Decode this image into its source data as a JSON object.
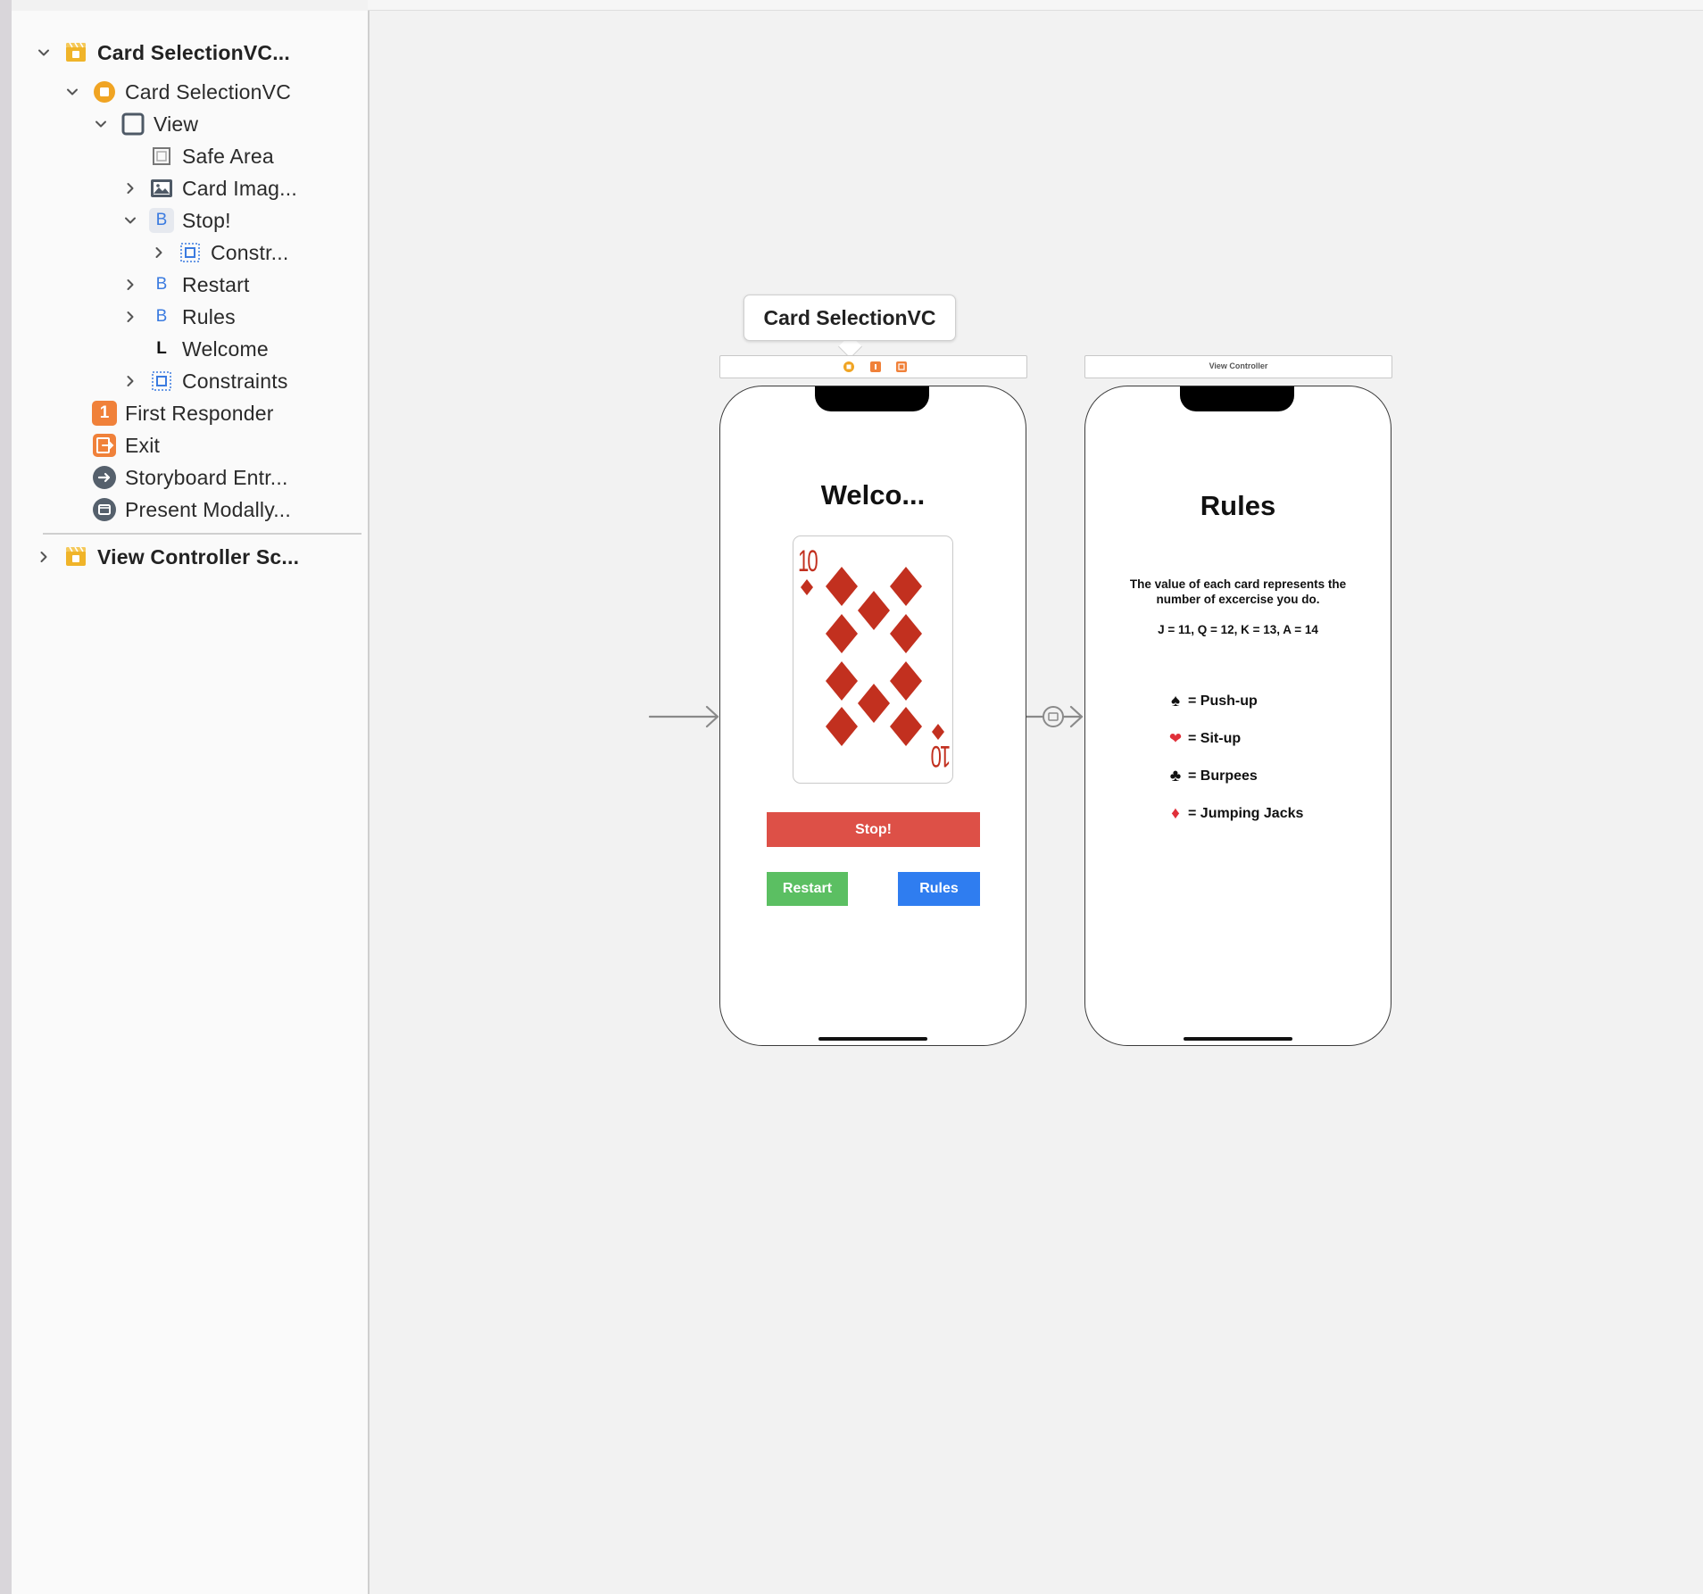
{
  "navigator": {
    "items": [
      {
        "label": "Card SelectionVC...",
        "icon": "scene-icon"
      },
      {
        "label": "Card SelectionVC",
        "icon": "view-controller-icon"
      },
      {
        "label": "View",
        "icon": "view-icon"
      },
      {
        "label": "Safe Area",
        "icon": "safe-area-icon"
      },
      {
        "label": "Card Imag...",
        "icon": "image-view-icon"
      },
      {
        "label": "Stop!",
        "icon": "button-icon",
        "glyph": "B"
      },
      {
        "label": "Constr...",
        "icon": "constraints-icon"
      },
      {
        "label": "Restart",
        "icon": "button-icon",
        "glyph": "B"
      },
      {
        "label": "Rules",
        "icon": "button-icon",
        "glyph": "B"
      },
      {
        "label": "Welcome",
        "icon": "label-icon",
        "glyph": "L"
      },
      {
        "label": "Constraints",
        "icon": "constraints-icon"
      },
      {
        "label": "First Responder",
        "icon": "first-responder-icon",
        "glyph": "1"
      },
      {
        "label": "Exit",
        "icon": "exit-icon"
      },
      {
        "label": "Storyboard Entr...",
        "icon": "storyboard-entry-icon"
      },
      {
        "label": "Present Modally...",
        "icon": "segue-icon"
      },
      {
        "label": "View Controller Sc...",
        "icon": "scene-icon"
      }
    ]
  },
  "canvas": {
    "callout_title": "Card SelectionVC",
    "second_scene_title": "View Controller",
    "main_screen": {
      "title": "Welco...",
      "card_rank": "10",
      "stop_label": "Stop!",
      "restart_label": "Restart",
      "rules_label": "Rules"
    },
    "rules_screen": {
      "title": "Rules",
      "description": "The value of each card represents the number of excercise you do.",
      "values": "J = 11, Q = 12, K = 13, A = 14",
      "suits": [
        {
          "symbol": "♠",
          "label": "= Push-up",
          "color": "#111111"
        },
        {
          "symbol": "❤",
          "label": "= Sit-up",
          "color": "#e0303a"
        },
        {
          "symbol": "♣",
          "label": "= Burpees",
          "color": "#111111"
        },
        {
          "symbol": "♦",
          "label": "= Jumping Jacks",
          "color": "#e0303a"
        }
      ]
    }
  },
  "colors": {
    "stop": "#dd5047",
    "restart": "#5bbf62",
    "rules": "#2f7df0",
    "card_red": "#c2301f",
    "scene_icon": "#f0b429"
  }
}
